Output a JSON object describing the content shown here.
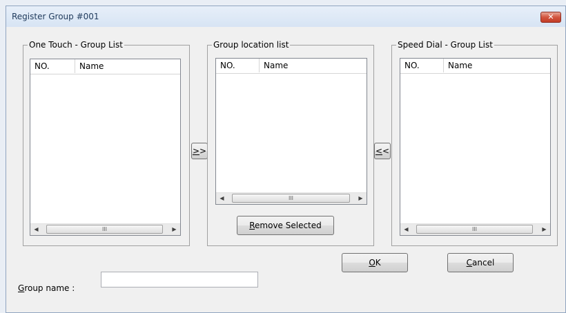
{
  "window": {
    "title": "Register Group #001",
    "close_glyph": "✕",
    "close_icon": "close-icon"
  },
  "list_columns": {
    "no": "NO.",
    "name": "Name"
  },
  "one_touch": {
    "label": "One Touch - Group List"
  },
  "location": {
    "label": "Group location list",
    "remove_hotkey": "R",
    "remove_rest": "emove Selected"
  },
  "speed_dial": {
    "label": "Speed Dial - Group List"
  },
  "buttons": {
    "add_hotkey": ">",
    "add_rest": ">",
    "back_hotkey": "<",
    "back_rest": "<",
    "ok_hotkey": "O",
    "ok_rest": "K",
    "cancel_hotkey": "C",
    "cancel_rest": "ancel"
  },
  "group_name": {
    "label_hotkey": "G",
    "label_rest": "roup name :",
    "value": ""
  },
  "scrollbar": {
    "left": "◀",
    "right": "▶",
    "grip": "III"
  },
  "colors": {
    "title_text": "#1e395b",
    "close_red": "#c33d27",
    "list_border": "#828790"
  }
}
